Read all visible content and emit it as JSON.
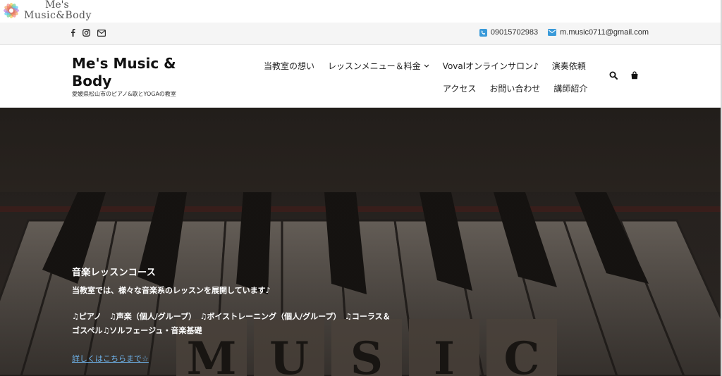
{
  "logo": {
    "line1": "Me's",
    "line2": "Music&Body"
  },
  "topbar": {
    "social": [
      "facebook-icon",
      "instagram-icon",
      "mail-icon"
    ],
    "phone": "09015702983",
    "email": "m.music0711@gmail.com"
  },
  "header": {
    "title": "Me's Music & Body",
    "tagline": "愛媛県松山市のピアノ&歌とYOGAの教室",
    "nav_row1": [
      {
        "label": "当教室の想い"
      },
      {
        "label": "レッスンメニュー＆料金"
      },
      {
        "label": "Vovalオンラインサロン♪"
      },
      {
        "label": "演奏依頼"
      }
    ],
    "nav_row2": [
      {
        "label": "アクセス"
      },
      {
        "label": "お問い合わせ"
      },
      {
        "label": "講師紹介"
      }
    ],
    "icons": [
      "search-icon",
      "cart-icon"
    ]
  },
  "hero": {
    "title": "音楽レッスンコース",
    "intro": "当教室では、様々な音楽系のレッスンを展開しています♪",
    "courses_line1": "♫ピアノ　♫声楽（個人/グループ）　♫ボイストレーニング（個人/グループ）　♫コーラス＆",
    "courses_line2": "ゴスペル♫ソルフェージュ・音楽基礎",
    "link": "詳しくはこちらまで☆",
    "image_text": "MUSIC"
  },
  "colors": {
    "accent": "#3a9ad9",
    "link": "#6fb4ec"
  }
}
